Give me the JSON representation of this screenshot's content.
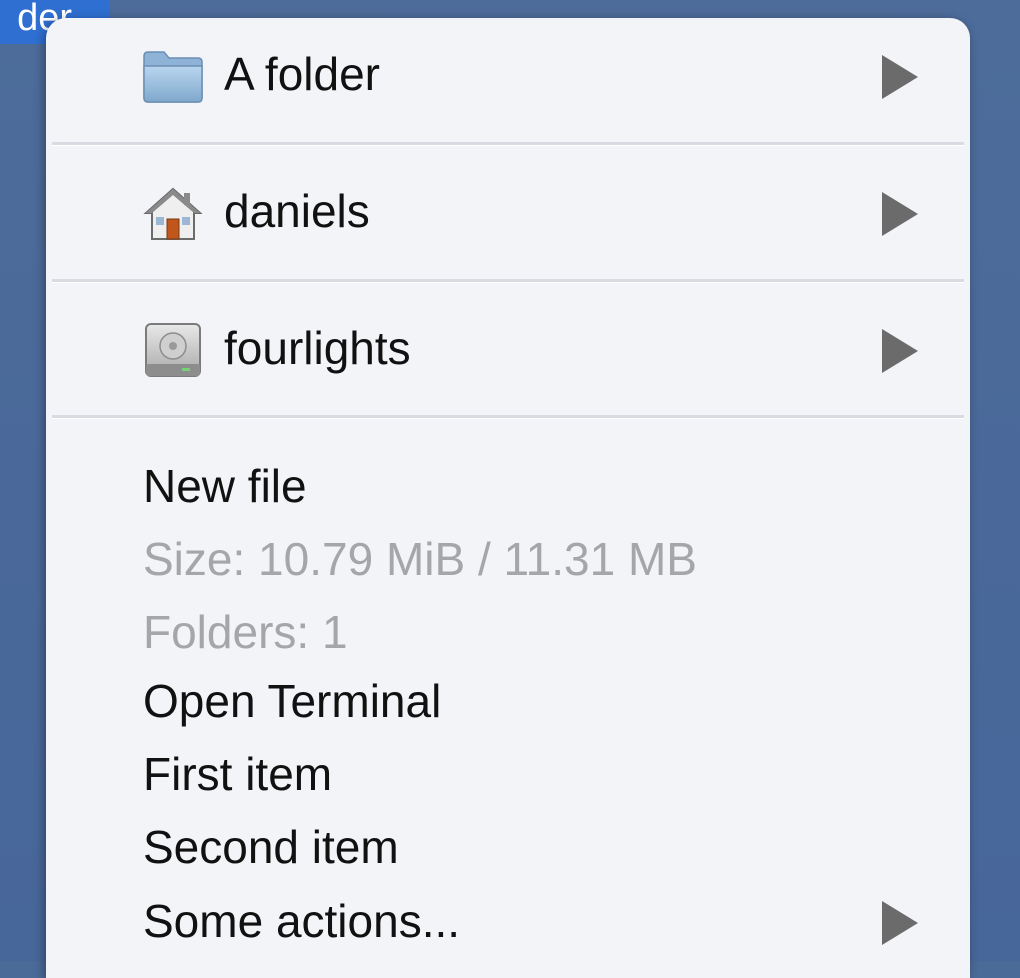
{
  "background": {
    "selected_label_fragment": "der"
  },
  "menu": {
    "places": [
      {
        "label": "A folder",
        "icon": "folder-icon"
      },
      {
        "label": "daniels",
        "icon": "home-icon"
      },
      {
        "label": "fourlights",
        "icon": "hard-drive-icon"
      }
    ],
    "items": {
      "new_file": "New file",
      "size": "Size: 10.79 MiB / 11.31 MB",
      "folders": "Folders: 1",
      "open_terminal": "Open Terminal",
      "first_item": "First item",
      "second_item": "Second item",
      "some_actions": "Some actions..."
    }
  },
  "colors": {
    "desktop": "#4a6a98",
    "menu_background": "#f3f4f8",
    "disabled_text": "#a4a6aa",
    "selection": "#2f6fd1"
  }
}
